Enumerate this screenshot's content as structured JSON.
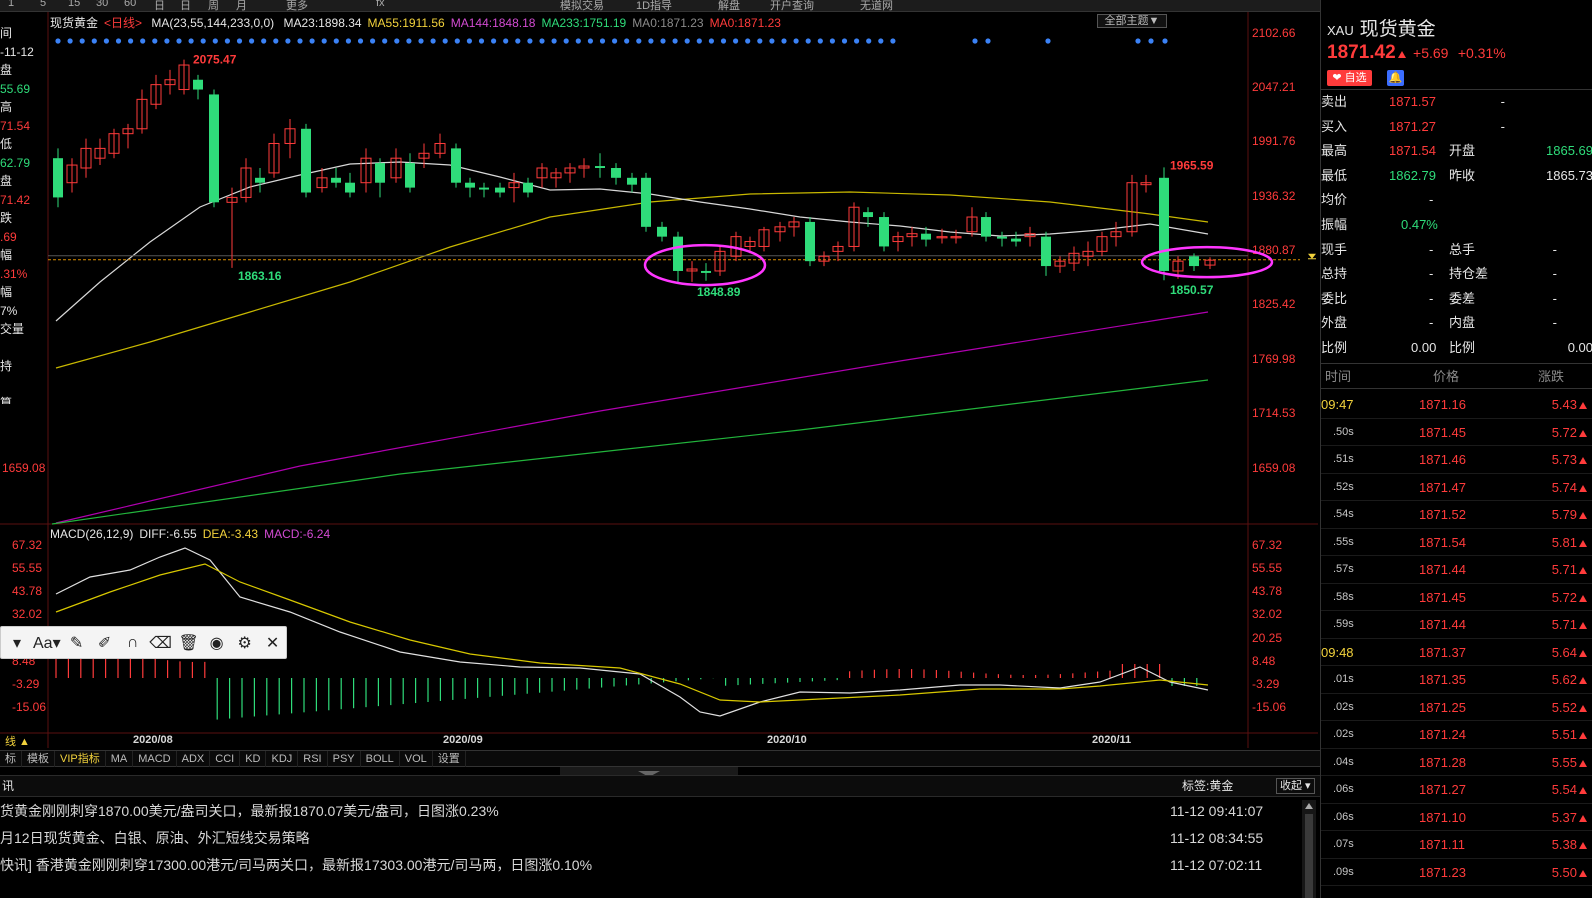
{
  "top_toolbar": [
    "1",
    "5",
    "15",
    "30",
    "60",
    "日",
    "日",
    "周",
    "月",
    "更多",
    "fx",
    "模拟交易",
    "1D指导",
    "解盘",
    "开户查询",
    "无道网"
  ],
  "chart": {
    "instrument": "现货黄金",
    "period_label": "<日线>",
    "ma_params": "MA(23,55,144,233,0,0)",
    "ma_values": [
      {
        "label": "MA23:1898.34",
        "color": "#e6e6e6"
      },
      {
        "label": "MA55:1911.56",
        "color": "#f2d23c"
      },
      {
        "label": "MA144:1848.18",
        "color": "#d24bd2"
      },
      {
        "label": "MA233:1751.19",
        "color": "#2fdc7a"
      },
      {
        "label": "MA0:1871.23",
        "color": "#8a8a8a"
      },
      {
        "label": "MA0:1871.23",
        "color": "#ff3b3b"
      }
    ],
    "theme_button": "全部主题▼",
    "price_axis_labels": [
      "2102.66",
      "2047.21",
      "1991.76",
      "1936.32",
      "1880.87",
      "1825.42",
      "1769.98",
      "1714.53",
      "1659.08"
    ],
    "left_axis_label": "1659.08",
    "annotations": {
      "high": "2075.47",
      "low_aug": "1863.16",
      "low_sep": "1848.89",
      "high_nov": "1965.59",
      "low_nov": "1850.57"
    },
    "date_labels": [
      "2020/08",
      "2020/09",
      "2020/10",
      "2020/11"
    ],
    "macd_legend": [
      {
        "label": "MACD(26,12,9)",
        "color": "#e6e6e6"
      },
      {
        "label": "DIFF:-6.55",
        "color": "#e6e6e6"
      },
      {
        "label": "DEA:-3.43",
        "color": "#f2d23c"
      },
      {
        "label": "MACD:-6.24",
        "color": "#d24bd2"
      }
    ],
    "macd_axis_labels": [
      "67.32",
      "55.55",
      "43.78",
      "32.02",
      "20.25",
      "8.48",
      "-3.29",
      "-15.06"
    ],
    "macd_left_labels": [
      "67.32",
      "55.55",
      "43.78",
      "32.02",
      "8.48",
      "-3.29",
      "-15.06"
    ]
  },
  "left_info": [
    "间",
    "-11-12",
    "盘",
    "55.69",
    "高",
    "71.54",
    "低",
    "62.79",
    "盘",
    "71.42",
    "跌",
    ".69",
    "幅",
    ".31%",
    "幅",
    "7%",
    "交量",
    "",
    "持",
    "",
    "算"
  ],
  "draw_toolbar": [
    "▾",
    "Aa▾",
    "pencil-icon",
    "brush-icon",
    "magnet-icon",
    "eraser-icon",
    "trash-icon",
    "eye-icon",
    "gear-icon",
    "close-icon"
  ],
  "indicator_tabs": {
    "corner_label": "线 ▲",
    "items": [
      "标",
      "模板",
      "VIP指标",
      "MA",
      "MACD",
      "ADX",
      "CCI",
      "KD",
      "KDJ",
      "RSI",
      "PSY",
      "BOLL",
      "VOL",
      "设置"
    ]
  },
  "news": {
    "header_left": "讯",
    "header_tag": "标签:黄金",
    "collapse_label": "收起 ▾",
    "rows": [
      {
        "text": "货黄金刚刚刺穿1870.00美元/盎司关口，最新报1870.07美元/盎司，日图涨0.23%",
        "time": "11-12 09:41:07"
      },
      {
        "text": "月12日现货黄金、白银、原油、外汇短线交易策略",
        "time": "11-12 08:34:55"
      },
      {
        "text": "快讯] 香港黄金刚刚刺穿17300.00港元/司马两关口，最新报17303.00港元/司马两，日图涨0.10%",
        "time": "11-12 07:02:11"
      }
    ]
  },
  "quote": {
    "code": "XAU",
    "name": "现货黄金",
    "price": "1871.42",
    "change": "+5.69",
    "change_pct": "+0.31%",
    "watch_label": "自选",
    "rows": [
      {
        "l1": "卖出",
        "v1": "1871.57",
        "v1c": "red",
        "l2": "",
        "v2": "-",
        "v2c": "white"
      },
      {
        "l1": "买入",
        "v1": "1871.27",
        "v1c": "red",
        "l2": "",
        "v2": "-",
        "v2c": "white"
      },
      {
        "l1": "最高",
        "v1": "1871.54",
        "v1c": "red",
        "l2": "开盘",
        "v2": "1865.69",
        "v2c": "green"
      },
      {
        "l1": "最低",
        "v1": "1862.79",
        "v1c": "green",
        "l2": "昨收",
        "v2": "1865.73",
        "v2c": "white"
      },
      {
        "l1": "均价",
        "v1": "-",
        "v1c": "white",
        "l2": "",
        "v2": "",
        "v2c": "white"
      },
      {
        "l1": "振幅",
        "v1": "0.47%",
        "v1c": "green",
        "l2": "",
        "v2": "",
        "v2c": "white"
      },
      {
        "l1": "现手",
        "v1": "-",
        "v1c": "white",
        "l2": "总手",
        "v2": "-",
        "v2c": "white"
      },
      {
        "l1": "总持",
        "v1": "-",
        "v1c": "white",
        "l2": "持仓差",
        "v2": "-",
        "v2c": "white"
      },
      {
        "l1": "委比",
        "v1": "-",
        "v1c": "white",
        "l2": "委差",
        "v2": "-",
        "v2c": "white"
      },
      {
        "l1": "外盘",
        "v1": "-",
        "v1c": "white",
        "l2": "内盘",
        "v2": "-",
        "v2c": "white"
      },
      {
        "l1": "比例",
        "v1": "0.00",
        "v1c": "white",
        "l2": "比例",
        "v2": "0.00",
        "v2c": "white"
      }
    ],
    "ticks_header": [
      "时间",
      "价格",
      "涨跌"
    ],
    "ticks": [
      {
        "time": "09:47",
        "price": "1871.16",
        "chg": "5.43"
      },
      {
        "time": ".50s",
        "price": "1871.45",
        "chg": "5.72"
      },
      {
        "time": ".51s",
        "price": "1871.46",
        "chg": "5.73"
      },
      {
        "time": ".52s",
        "price": "1871.47",
        "chg": "5.74"
      },
      {
        "time": ".54s",
        "price": "1871.52",
        "chg": "5.79"
      },
      {
        "time": ".55s",
        "price": "1871.54",
        "chg": "5.81"
      },
      {
        "time": ".57s",
        "price": "1871.44",
        "chg": "5.71"
      },
      {
        "time": ".58s",
        "price": "1871.45",
        "chg": "5.72"
      },
      {
        "time": ".59s",
        "price": "1871.44",
        "chg": "5.71"
      },
      {
        "time": "09:48",
        "price": "1871.37",
        "chg": "5.64"
      },
      {
        "time": ".01s",
        "price": "1871.35",
        "chg": "5.62"
      },
      {
        "time": ".02s",
        "price": "1871.25",
        "chg": "5.52"
      },
      {
        "time": ".02s",
        "price": "1871.24",
        "chg": "5.51"
      },
      {
        "time": ".04s",
        "price": "1871.28",
        "chg": "5.55"
      },
      {
        "time": ".06s",
        "price": "1871.27",
        "chg": "5.54"
      },
      {
        "time": ".06s",
        "price": "1871.10",
        "chg": "5.37"
      },
      {
        "time": ".07s",
        "price": "1871.11",
        "chg": "5.38"
      },
      {
        "time": ".09s",
        "price": "1871.23",
        "chg": "5.50"
      }
    ]
  }
}
